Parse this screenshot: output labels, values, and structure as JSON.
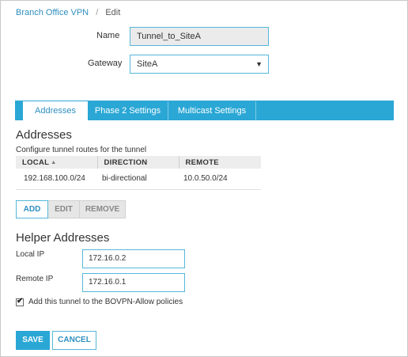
{
  "breadcrumb": {
    "parent": "Branch Office VPN",
    "separator": "/",
    "current": "Edit"
  },
  "form": {
    "name_label": "Name",
    "name_value": "Tunnel_to_SiteA",
    "gateway_label": "Gateway",
    "gateway_value": "SiteA"
  },
  "tabs": [
    {
      "label": "Addresses",
      "active": true
    },
    {
      "label": "Phase 2 Settings",
      "active": false
    },
    {
      "label": "Multicast Settings",
      "active": false
    }
  ],
  "addresses": {
    "title": "Addresses",
    "description": "Configure tunnel routes for the tunnel",
    "columns": [
      "LOCAL",
      "DIRECTION",
      "REMOTE"
    ],
    "rows": [
      {
        "local": "192.168.100.0/24",
        "direction": "bi-directional",
        "remote": "10.0.50.0/24"
      }
    ],
    "buttons": {
      "add": "ADD",
      "edit": "EDIT",
      "remove": "REMOVE"
    }
  },
  "helper": {
    "title": "Helper Addresses",
    "local_label": "Local IP",
    "local_value": "172.16.0.2",
    "remote_label": "Remote IP",
    "remote_value": "172.16.0.1"
  },
  "policy_checkbox": {
    "checked": true,
    "label": "Add this tunnel to the BOVPN-Allow policies"
  },
  "actions": {
    "save": "SAVE",
    "cancel": "CANCEL"
  },
  "icons": {
    "sort": "sort-up-icon",
    "dropdown": "caret-down-icon",
    "check": "checkmark-icon"
  },
  "colors": {
    "accent": "#2aa7d5",
    "link": "#2e8fbf"
  }
}
